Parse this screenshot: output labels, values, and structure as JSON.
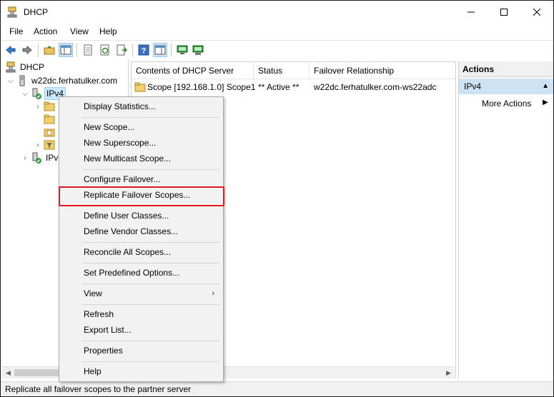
{
  "window": {
    "title": "DHCP"
  },
  "menubar": {
    "items": [
      "File",
      "Action",
      "View",
      "Help"
    ]
  },
  "tree": {
    "root": "DHCP",
    "server": "w22dc.ferhatulker.com",
    "ipv4": "IPv4",
    "ipv6": "IPv6"
  },
  "list": {
    "columns": [
      "Contents of DHCP Server",
      "Status",
      "Failover Relationship"
    ],
    "rows": [
      {
        "name": "Scope [192.168.1.0] Scope1",
        "status": "** Active **",
        "failover": "w22dc.ferhatulker.com-ws22adc"
      }
    ]
  },
  "actions": {
    "title": "Actions",
    "group": "IPv4",
    "more": "More Actions"
  },
  "context_menu": {
    "items": [
      "Display Statistics...",
      "New Scope...",
      "New Superscope...",
      "New Multicast Scope...",
      "Configure Failover...",
      "Replicate Failover Scopes...",
      "Define User Classes...",
      "Define Vendor Classes...",
      "Reconcile All Scopes...",
      "Set Predefined Options...",
      "View",
      "Refresh",
      "Export List...",
      "Properties",
      "Help"
    ],
    "highlighted": "Replicate Failover Scopes..."
  },
  "statusbar": {
    "text": "Replicate all failover scopes to the partner server"
  },
  "colors": {
    "highlight_border": "#e0181e",
    "selection_bg": "#cce8ff",
    "actions_group_bg": "#cde3f5"
  }
}
